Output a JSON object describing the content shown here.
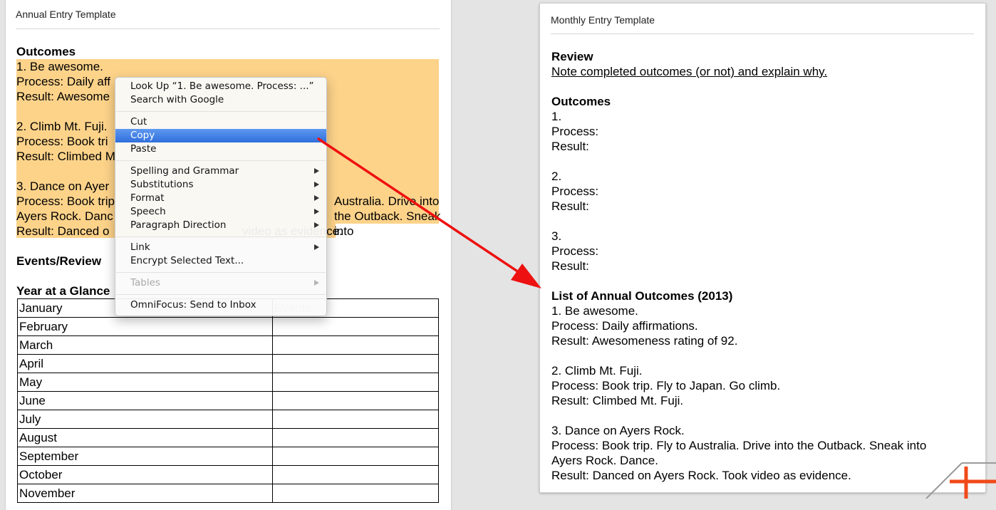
{
  "left": {
    "title": "Annual Entry Template",
    "outcomes_heading": "Outcomes",
    "outcome_lines": [
      "1. Be awesome.",
      "Process: Daily aff",
      "Result: Awesome",
      "",
      "2. Climb Mt. Fuji.",
      "Process: Book tri",
      "Result: Climbed M",
      "",
      "3. Dance on Ayer",
      "Process: Book trip",
      "Ayers Rock. Danc",
      "Result: Danced o"
    ],
    "peek_fragments": {
      "line10": "Australia. Drive into the Outback. Sneak into",
      "line12": "video as evidence."
    },
    "events_heading": "Events/Review",
    "year_heading": "Year at a Glance",
    "table_header_events": "Events",
    "months": [
      "January",
      "February",
      "March",
      "April",
      "May",
      "June",
      "July",
      "August",
      "September",
      "October",
      "November"
    ]
  },
  "menu": {
    "items": [
      {
        "label": "Look Up “1. Be awesome. Process: ...”"
      },
      {
        "label": "Search with Google"
      },
      {
        "label": "Cut"
      },
      {
        "label": "Copy"
      },
      {
        "label": "Paste"
      },
      {
        "label": "Spelling and Grammar"
      },
      {
        "label": "Substitutions"
      },
      {
        "label": "Format"
      },
      {
        "label": "Speech"
      },
      {
        "label": "Paragraph Direction"
      },
      {
        "label": "Link"
      },
      {
        "label": "Encrypt Selected Text..."
      },
      {
        "label": "Tables"
      },
      {
        "label": "OmniFocus: Send to Inbox"
      }
    ],
    "active_item": "Copy",
    "highlight_color": "#2f6fdc"
  },
  "right": {
    "title": "Monthly Entry Template",
    "lines": [
      "Review",
      "Note completed outcomes (or not) and explain why.",
      "",
      "Outcomes",
      "1.",
      "Process:",
      "Result:",
      "",
      "2.",
      "Process:",
      "Result:",
      "",
      "3.",
      "Process:",
      "Result:",
      "",
      "List of Annual Outcomes (2013)",
      "1. Be awesome.",
      "Process: Daily affirmations.",
      "Result: Awesomeness rating of 92.",
      "",
      "2. Climb Mt. Fuji.",
      "Process: Book trip. Fly to Japan. Go climb.",
      "Result: Climbed Mt. Fuji.",
      "",
      "3. Dance on Ayers Rock.",
      "Process: Book trip. Fly to Australia. Drive into the Outback. Sneak into",
      "Ayers Rock. Dance.",
      "Result: Danced on Ayers Rock. Took video as evidence."
    ]
  },
  "colors": {
    "selection_highlight": "#fdd38a",
    "arrow": "#ee1111",
    "corner_logo": "#f04a1a"
  }
}
